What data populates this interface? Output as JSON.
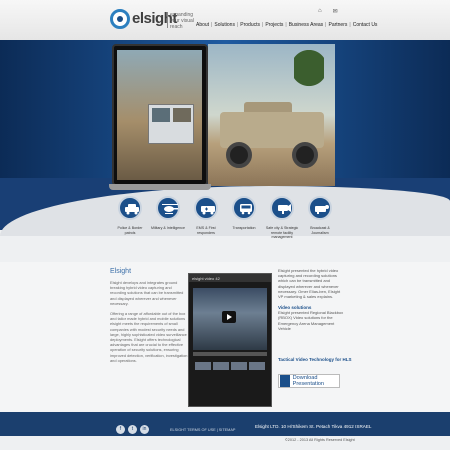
{
  "brand": {
    "name": "elsight",
    "tagline": "expanding your visual reach"
  },
  "top_icons": [
    "home-icon",
    "email-icon"
  ],
  "nav": {
    "items": [
      "About",
      "Solutions",
      "Products",
      "Projects",
      "Business Areas",
      "Partners",
      "Contact Us"
    ]
  },
  "features": [
    {
      "label": "Police & Border patrols",
      "icon": "police-car-icon"
    },
    {
      "label": "Military & Intelligence",
      "icon": "helicopter-icon"
    },
    {
      "label": "EMS & First responders",
      "icon": "ambulance-icon"
    },
    {
      "label": "Transportation",
      "icon": "bus-icon"
    },
    {
      "label": "Safe city & Strategic remote facility management",
      "icon": "camera-icon"
    },
    {
      "label": "Broadcast & Journalism",
      "icon": "broadcast-icon"
    }
  ],
  "about": {
    "title": "Elsight",
    "para1": "Elsight develops and integrates ground breaking hybrid video capturing and recording solutions that can be transmitted and displayed wherever and whenever necessary.",
    "para2": "Offering a range of affordable out of the box and tailor made hybrid and mobile solutions elsight meets the requirements of small companies with modest security needs and large, highly sophisticated video surveillance deployments. Elsight offers technological advantages that are crucial to the effective operation of security solutions, ensuring improved detection, verification, investigation and operations."
  },
  "video": {
    "title": "elsight video 42"
  },
  "right": {
    "intro": "Elsight presented the hybrid video capturing and recording solutions which can be transmitted and displayed wherever and whenever necessary. Omer Elias-ben, Elsight VP marketing & sales explains.",
    "video_title": "Video solutions",
    "video_text": "Elsight presented Regional Blackbox (RBOX) Video solutions for the Emergency Arena Management Vehicle",
    "tactical": "Tactical Video Technology for HLS",
    "download": "Download Presentation"
  },
  "footer": {
    "social": [
      "facebook-icon",
      "twitter-icon",
      "linkedin-icon"
    ],
    "mid_text": "ELSIGHT TERMS OF USE   |   SITEMAP",
    "address": "Elsight LTD. 10 Hi'Shikem St. Petach Tikva 4912 ISRAEL",
    "copyright": "©2012 - 2013 All Rights Reserved Elsight"
  }
}
